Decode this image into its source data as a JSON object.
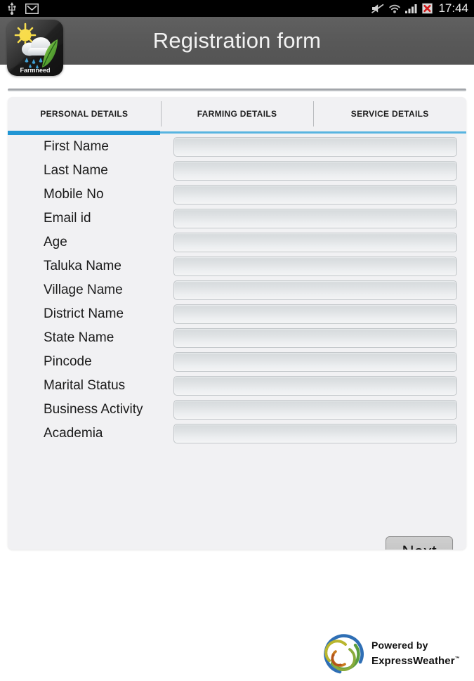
{
  "status_bar": {
    "left_icons": [
      "usb-icon",
      "gmail-icon"
    ],
    "right_icons": [
      "mute-icon",
      "wifi-icon",
      "signal-bars-icon",
      "sim-error-icon"
    ],
    "time": "17:44"
  },
  "app": {
    "icon_name": "farmneed-app-icon",
    "icon_label": "Farmneed",
    "title": "Registration form"
  },
  "tabs": [
    {
      "label": "PERSONAL DETAILS",
      "active": true
    },
    {
      "label": "FARMING  DETAILS",
      "active": false
    },
    {
      "label": "SERVICE  DETAILS",
      "active": false
    }
  ],
  "form": {
    "fields": [
      {
        "label": "First Name",
        "value": "",
        "placeholder": ""
      },
      {
        "label": "Last Name",
        "value": "",
        "placeholder": ""
      },
      {
        "label": "Mobile No",
        "value": "",
        "placeholder": ""
      },
      {
        "label": "Email id",
        "value": "",
        "placeholder": ""
      },
      {
        "label": "Age",
        "value": "",
        "placeholder": ""
      },
      {
        "label": "Taluka Name",
        "value": "",
        "placeholder": ""
      },
      {
        "label": "Village Name",
        "value": "",
        "placeholder": ""
      },
      {
        "label": "District Name",
        "value": "",
        "placeholder": ""
      },
      {
        "label": "State Name",
        "value": "",
        "placeholder": ""
      },
      {
        "label": "Pincode",
        "value": "",
        "placeholder": ""
      },
      {
        "label": "Marital Status",
        "value": "",
        "placeholder": ""
      },
      {
        "label": "Business Activity",
        "value": "",
        "placeholder": ""
      },
      {
        "label": "Academia",
        "value": "",
        "placeholder": ""
      }
    ],
    "next_label": "Next"
  },
  "footer": {
    "powered_by": "Powered by",
    "brand": "ExpressWeather",
    "trademark": "™",
    "logo_name": "expressweather-logo"
  },
  "colors": {
    "status_bar_bg": "#000000",
    "action_bar_bg": "#5b5b5b",
    "card_bg": "#f1f1f3",
    "tab_active_underline": "#2196d4",
    "tab_inactive_underline": "#58b4e0",
    "page_bg": "#ffffff"
  }
}
